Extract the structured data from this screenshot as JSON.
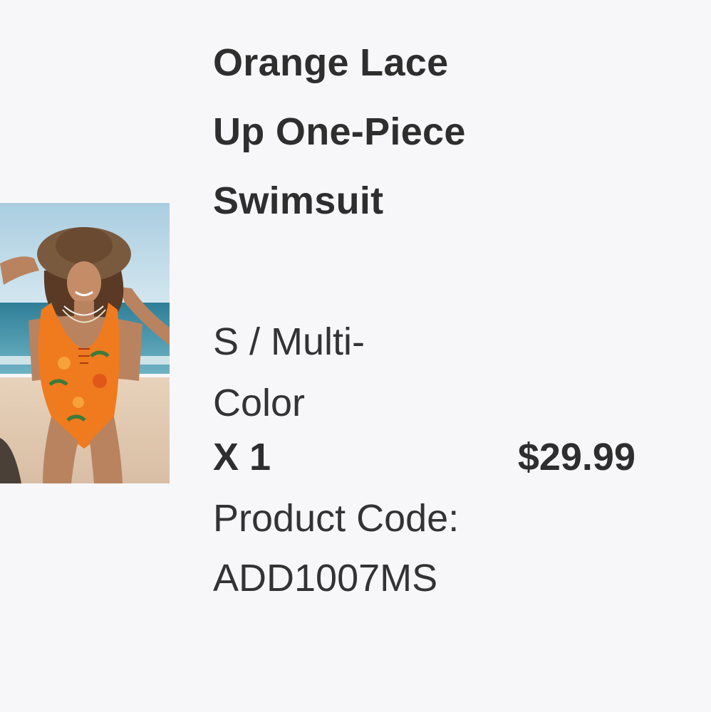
{
  "product": {
    "title": "Orange Lace Up One-Piece Swimsuit",
    "variant": "S / Multi-Color",
    "quantity": "X 1",
    "price": "$29.99",
    "code_label": "Product Code:",
    "code_value": "ADD1007MS",
    "image_icon": "product-photo"
  },
  "colors": {
    "background": "#f7f7f9",
    "text": "#2e2e2e",
    "swimsuit": "#f07a1e"
  }
}
